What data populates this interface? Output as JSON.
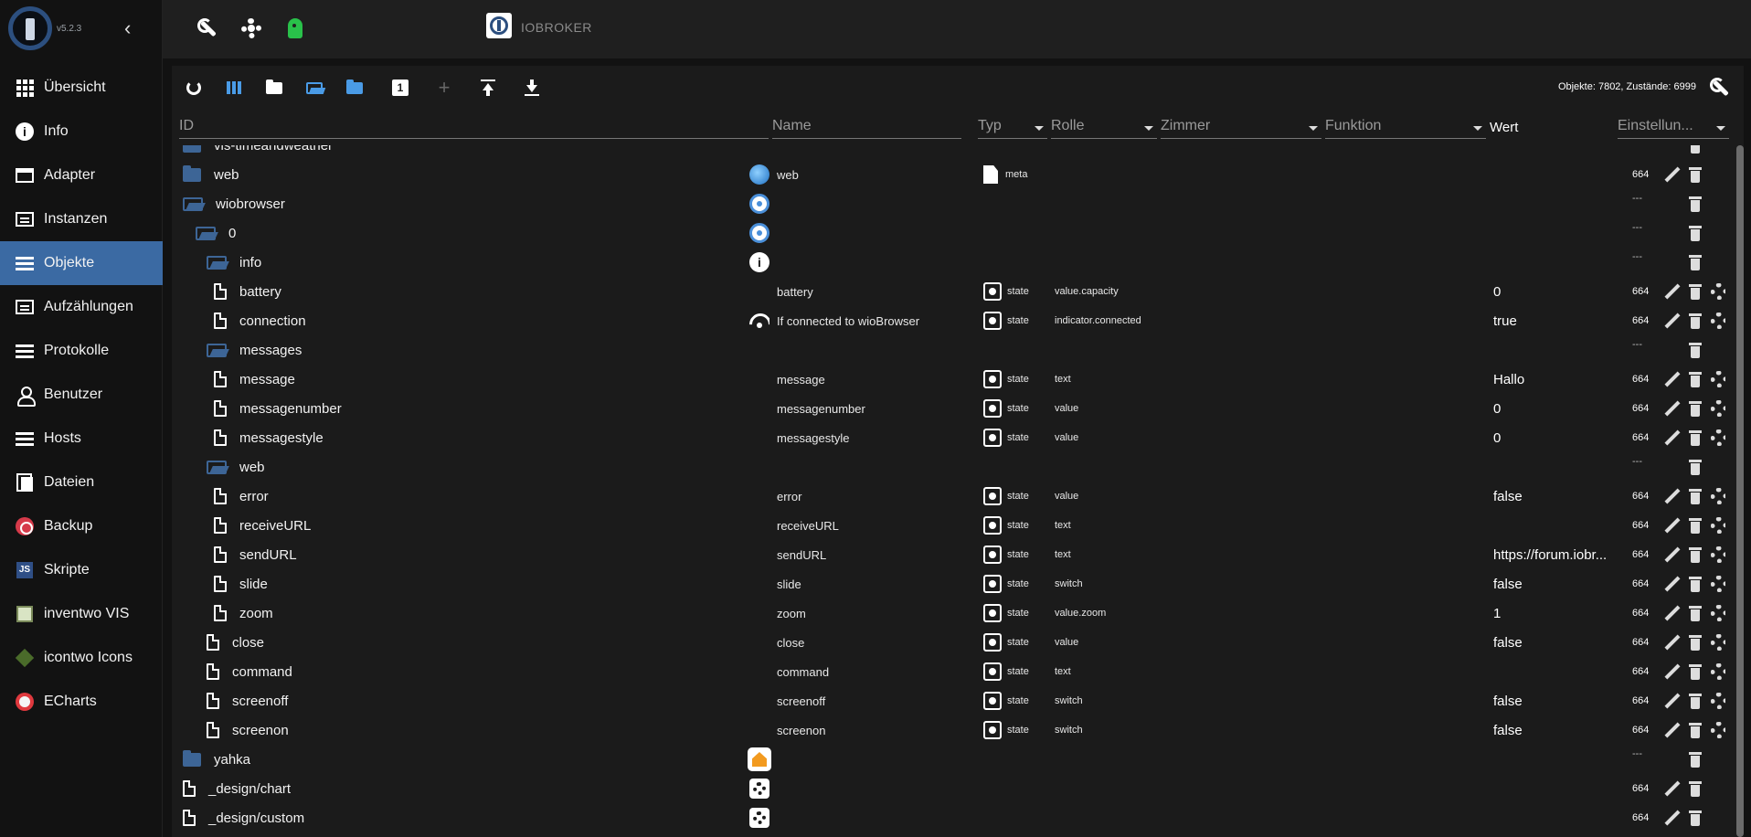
{
  "app": {
    "version": "v5.2.3",
    "title": "IOBROKER",
    "object_counts": "Objekte: 7802, Zustände: 6999"
  },
  "sidebar": {
    "items": [
      {
        "label": "Übersicht",
        "icon": "grid-icon"
      },
      {
        "label": "Info",
        "icon": "info-icon"
      },
      {
        "label": "Adapter",
        "icon": "store-icon"
      },
      {
        "label": "Instanzen",
        "icon": "instances-icon"
      },
      {
        "label": "Objekte",
        "icon": "list-icon",
        "active": true
      },
      {
        "label": "Aufzählungen",
        "icon": "enum-icon"
      },
      {
        "label": "Protokolle",
        "icon": "log-icon"
      },
      {
        "label": "Benutzer",
        "icon": "user-icon"
      },
      {
        "label": "Hosts",
        "icon": "hosts-icon"
      },
      {
        "label": "Dateien",
        "icon": "files-icon"
      },
      {
        "label": "Backup",
        "icon": "backup-icon"
      },
      {
        "label": "Skripte",
        "icon": "js-icon"
      },
      {
        "label": "inventwo VIS",
        "icon": "inventwo-icon"
      },
      {
        "label": "icontwo Icons",
        "icon": "icontwo-icon"
      },
      {
        "label": "ECharts",
        "icon": "echarts-icon"
      }
    ]
  },
  "table": {
    "headers": {
      "id": "ID",
      "name": "Name",
      "typ": "Typ",
      "rolle": "Rolle",
      "zimmer": "Zimmer",
      "funktion": "Funktion",
      "wert": "Wert",
      "einstellungen": "Einstellun..."
    },
    "rows": [
      {
        "id": "vis-timeandweather",
        "level": 0,
        "kind": "folder",
        "nicon": "",
        "name": "",
        "typ": "",
        "role": "",
        "value": "",
        "acl": "",
        "actions": "del"
      },
      {
        "id": "web",
        "level": 0,
        "kind": "folder",
        "nicon": "globe",
        "name": "web",
        "typ": "meta",
        "typicon": "meta",
        "role": "",
        "value": "",
        "acl": "664",
        "actions": "edit-del"
      },
      {
        "id": "wiobrowser",
        "level": 0,
        "kind": "folder-open",
        "nicon": "wio",
        "name": "",
        "typ": "",
        "role": "",
        "value": "",
        "acl": "---",
        "actions": "del"
      },
      {
        "id": "0",
        "level": 1,
        "kind": "folder-open",
        "nicon": "wio",
        "name": "",
        "typ": "",
        "role": "",
        "value": "",
        "acl": "---",
        "actions": "del"
      },
      {
        "id": "info",
        "level": 2,
        "kind": "folder-open",
        "nicon": "info",
        "name": "",
        "typ": "",
        "role": "",
        "value": "",
        "acl": "---",
        "actions": "del"
      },
      {
        "id": "battery",
        "level": 3,
        "kind": "doc",
        "nicon": "",
        "name": "battery",
        "typ": "state",
        "typicon": "state",
        "role": "value.capacity",
        "value": "0",
        "acl": "664",
        "actions": "edit-del-gear"
      },
      {
        "id": "connection",
        "level": 3,
        "kind": "doc",
        "nicon": "wifi",
        "name": "If connected to wioBrowser",
        "typ": "state",
        "typicon": "state",
        "role": "indicator.connected",
        "value": "true",
        "acl": "664",
        "actions": "edit-del-gear"
      },
      {
        "id": "messages",
        "level": 2,
        "kind": "folder-open",
        "nicon": "",
        "name": "",
        "typ": "",
        "role": "",
        "value": "",
        "acl": "---",
        "actions": "del"
      },
      {
        "id": "message",
        "level": 3,
        "kind": "doc",
        "nicon": "",
        "name": "message",
        "typ": "state",
        "typicon": "state",
        "role": "text",
        "value": "Hallo",
        "acl": "664",
        "actions": "edit-del-gear"
      },
      {
        "id": "messagenumber",
        "level": 3,
        "kind": "doc",
        "nicon": "",
        "name": "messagenumber",
        "typ": "state",
        "typicon": "state",
        "role": "value",
        "value": "0",
        "acl": "664",
        "actions": "edit-del-gear"
      },
      {
        "id": "messagestyle",
        "level": 3,
        "kind": "doc",
        "nicon": "",
        "name": "messagestyle",
        "typ": "state",
        "typicon": "state",
        "role": "value",
        "value": "0",
        "acl": "664",
        "actions": "edit-del-gear"
      },
      {
        "id": "web",
        "level": 2,
        "kind": "folder-open",
        "nicon": "",
        "name": "",
        "typ": "",
        "role": "",
        "value": "",
        "acl": "---",
        "actions": "del"
      },
      {
        "id": "error",
        "level": 3,
        "kind": "doc",
        "nicon": "",
        "name": "error",
        "typ": "state",
        "typicon": "state",
        "role": "value",
        "value": "false",
        "acl": "664",
        "actions": "edit-del-gear"
      },
      {
        "id": "receiveURL",
        "level": 3,
        "kind": "doc",
        "nicon": "",
        "name": "receiveURL",
        "typ": "state",
        "typicon": "state",
        "role": "text",
        "value": "",
        "acl": "664",
        "actions": "edit-del-gear"
      },
      {
        "id": "sendURL",
        "level": 3,
        "kind": "doc",
        "nicon": "",
        "name": "sendURL",
        "typ": "state",
        "typicon": "state",
        "role": "text",
        "value": "https://forum.iobr...",
        "acl": "664",
        "actions": "edit-del-gear"
      },
      {
        "id": "slide",
        "level": 3,
        "kind": "doc",
        "nicon": "",
        "name": "slide",
        "typ": "state",
        "typicon": "state",
        "role": "switch",
        "value": "false",
        "acl": "664",
        "actions": "edit-del-gear"
      },
      {
        "id": "zoom",
        "level": 3,
        "kind": "doc",
        "nicon": "",
        "name": "zoom",
        "typ": "state",
        "typicon": "state",
        "role": "value.zoom",
        "value": "1",
        "acl": "664",
        "actions": "edit-del-gear"
      },
      {
        "id": "close",
        "level": 2,
        "kind": "doc",
        "nicon": "",
        "name": "close",
        "typ": "state",
        "typicon": "state",
        "role": "value",
        "value": "false",
        "acl": "664",
        "actions": "edit-del-gear"
      },
      {
        "id": "command",
        "level": 2,
        "kind": "doc",
        "nicon": "",
        "name": "command",
        "typ": "state",
        "typicon": "state",
        "role": "text",
        "value": "",
        "acl": "664",
        "actions": "edit-del-gear"
      },
      {
        "id": "screenoff",
        "level": 2,
        "kind": "doc",
        "nicon": "",
        "name": "screenoff",
        "typ": "state",
        "typicon": "state",
        "role": "switch",
        "value": "false",
        "acl": "664",
        "actions": "edit-del-gear"
      },
      {
        "id": "screenon",
        "level": 2,
        "kind": "doc",
        "nicon": "",
        "name": "screenon",
        "typ": "state",
        "typicon": "state",
        "role": "switch",
        "value": "false",
        "acl": "664",
        "actions": "edit-del-gear"
      },
      {
        "id": "yahka",
        "level": 0,
        "kind": "folder",
        "nicon": "home",
        "name": "",
        "typ": "",
        "role": "",
        "value": "",
        "acl": "---",
        "actions": "del"
      },
      {
        "id": "_design/chart",
        "level": 0,
        "kind": "doc",
        "nicon": "gear",
        "name": "",
        "typ": "",
        "role": "",
        "value": "",
        "acl": "664",
        "actions": "edit-del"
      },
      {
        "id": "_design/custom",
        "level": 0,
        "kind": "doc",
        "nicon": "gear",
        "name": "",
        "typ": "",
        "role": "",
        "value": "",
        "acl": "664",
        "actions": "edit-del"
      }
    ]
  }
}
